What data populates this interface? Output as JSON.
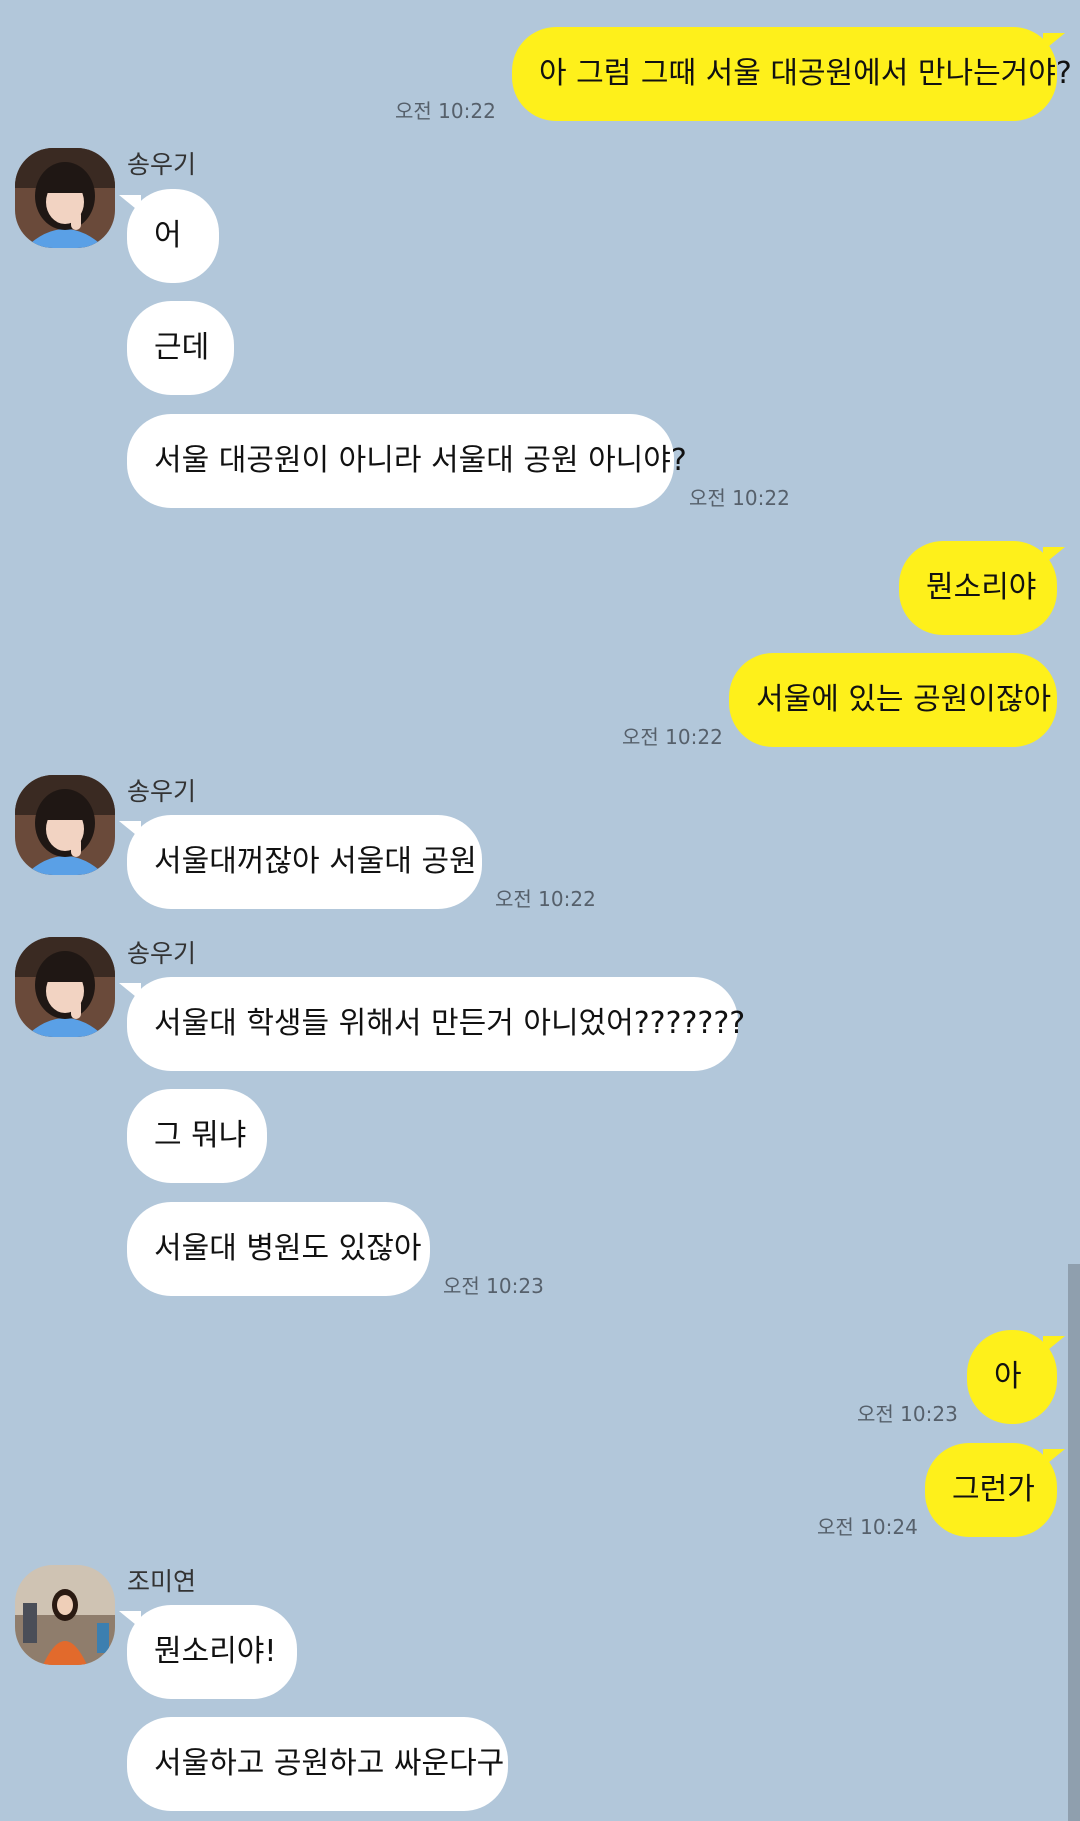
{
  "contacts": {
    "song": "송우기",
    "jo": "조미연"
  },
  "messages": [
    {
      "side": "out",
      "text": "아 그럼 그때 서울 대공원에서 만나는거야?",
      "time": "오전 10:22"
    },
    {
      "side": "in",
      "sender": "송우기",
      "text": "어"
    },
    {
      "side": "in",
      "text": "근데"
    },
    {
      "side": "in",
      "text": "서울 대공원이 아니라 서울대 공원 아니야?",
      "time": "오전 10:22"
    },
    {
      "side": "out",
      "text": "뭔소리야"
    },
    {
      "side": "out",
      "text": "서울에 있는 공원이잖아",
      "time": "오전 10:22"
    },
    {
      "side": "in",
      "sender": "송우기",
      "text": "서울대꺼잖아 서울대 공원",
      "time": "오전 10:22"
    },
    {
      "side": "in",
      "sender": "송우기",
      "text": "서울대 학생들 위해서 만든거 아니었어???????"
    },
    {
      "side": "in",
      "text": "그 뭐냐"
    },
    {
      "side": "in",
      "text": "서울대 병원도 있잖아",
      "time": "오전 10:23"
    },
    {
      "side": "out",
      "text": "아",
      "time": "오전 10:23"
    },
    {
      "side": "out",
      "text": "그런가",
      "time": "오전 10:24"
    },
    {
      "side": "in",
      "sender": "조미연",
      "text": "뭔소리야!"
    },
    {
      "side": "in",
      "text": "서울하고 공원하고 싸운다구"
    }
  ],
  "colors": {
    "background": "#b2c7da",
    "outgoing_bubble": "#fef01b",
    "incoming_bubble": "#ffffff"
  }
}
